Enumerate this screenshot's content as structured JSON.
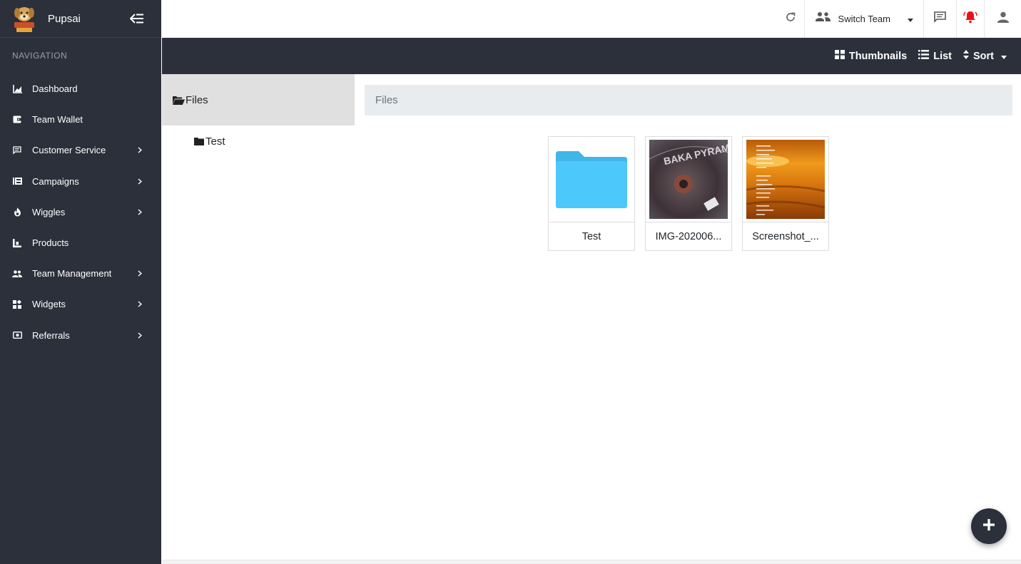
{
  "brand": {
    "name": "Pupsai",
    "logo_icon": "dog-logo-icon"
  },
  "sidebar": {
    "heading": "NAVIGATION",
    "items": [
      {
        "label": "Dashboard",
        "icon": "chart-area-icon",
        "has_children": false
      },
      {
        "label": "Team Wallet",
        "icon": "wallet-icon",
        "has_children": false
      },
      {
        "label": "Customer Service",
        "icon": "chat-icon",
        "has_children": true
      },
      {
        "label": "Campaigns",
        "icon": "campaign-icon",
        "has_children": true
      },
      {
        "label": "Wiggles",
        "icon": "fire-icon",
        "has_children": true
      },
      {
        "label": "Products",
        "icon": "product-icon",
        "has_children": false
      },
      {
        "label": "Team Management",
        "icon": "people-icon",
        "has_children": true
      },
      {
        "label": "Widgets",
        "icon": "widgets-icon",
        "has_children": true
      },
      {
        "label": "Referrals",
        "icon": "referral-icon",
        "has_children": true
      }
    ]
  },
  "header": {
    "switch_team_label": "Switch Team",
    "colors": {
      "bell": "#e8101a"
    }
  },
  "toolbar": {
    "thumbnails_label": "Thumbnails",
    "list_label": "List",
    "sort_label": "Sort"
  },
  "tree": {
    "root_label": "Files",
    "children": [
      {
        "label": "Test"
      }
    ]
  },
  "breadcrumb": {
    "label": "Files"
  },
  "files": [
    {
      "name": "Test",
      "type": "folder",
      "icon": "folder-icon"
    },
    {
      "name": "IMG-202006...",
      "type": "image",
      "icon": "photo-thumbnail"
    },
    {
      "name": "Screenshot_...",
      "type": "image",
      "icon": "screenshot-thumbnail"
    }
  ],
  "colors": {
    "sidebar_bg": "#2b303b",
    "folder": "#4cc9fa",
    "accent_dark": "#2b303b"
  }
}
